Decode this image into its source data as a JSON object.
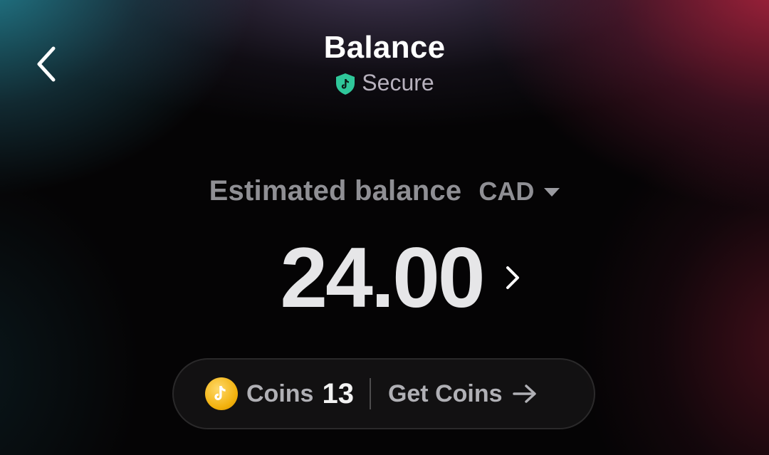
{
  "header": {
    "title": "Balance",
    "secure_label": "Secure"
  },
  "balance": {
    "label": "Estimated balance",
    "currency": "CAD",
    "amount": "24.00"
  },
  "coins": {
    "label": "Coins",
    "count": "13",
    "get_label": "Get Coins"
  },
  "colors": {
    "shield": "#2fc79a",
    "coin": "#f2b10c",
    "background": "#050405"
  }
}
